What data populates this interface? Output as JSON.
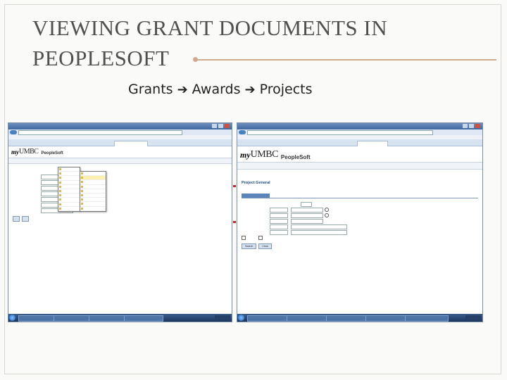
{
  "slide": {
    "title": "VIEWING GRANT DOCUMENTS IN PEOPLESOFT",
    "breadcrumb": [
      "Grants",
      "Awards",
      "Projects"
    ]
  },
  "colors": {
    "title_text": "#505050",
    "accent_rule": "#cfa98d",
    "ps_heading": "#1d4f8a",
    "highlight_marker": "#c8261f"
  },
  "left_screenshot": {
    "brand_my": "my",
    "brand_umbc": "UMBC",
    "brand_ps": "PeopleSoft"
  },
  "right_screenshot": {
    "brand_my": "my",
    "brand_umbc": "UMBC",
    "brand_ps": "PeopleSoft",
    "heading": "Project General",
    "search_button": "Search",
    "clear_button": "Clear"
  }
}
